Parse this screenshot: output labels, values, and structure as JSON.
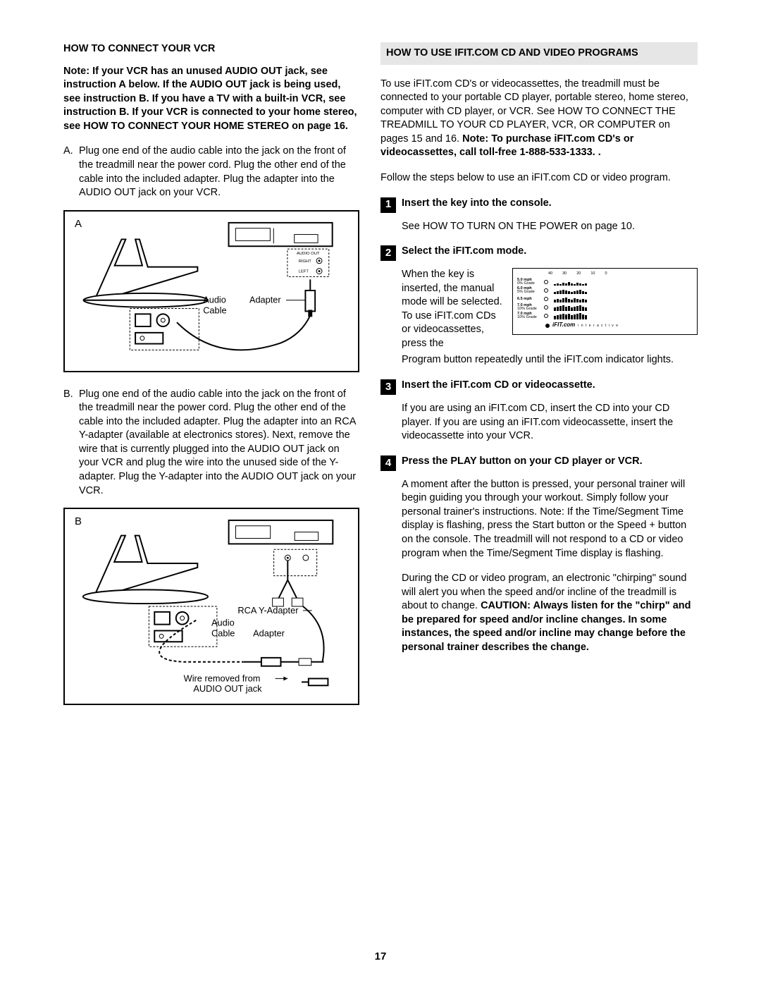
{
  "pageNumber": "17",
  "left": {
    "heading": "HOW TO CONNECT YOUR VCR",
    "note": "Note: If your VCR has an unused AUDIO OUT jack, see instruction A below. If the AUDIO OUT jack is being used, see instruction B. If you have a TV with a built-in VCR, see instruction B. If your VCR is connected to your home stereo, see HOW TO CONNECT YOUR HOME STEREO on page 16.",
    "stepA_marker": "A.",
    "stepA_text": "Plug one end of the audio cable into the jack on the front of the treadmill near the power cord. Plug the other end of the cable into the included adapter. Plug the adapter into the AUDIO OUT jack on your VCR.",
    "figA": {
      "label": "A",
      "audio_out": "AUDIO OUT",
      "right": "RIGHT",
      "left": "LEFT",
      "audio_cable": "Audio Cable",
      "adapter": "Adapter"
    },
    "stepB_marker": "B.",
    "stepB_text": "Plug one end of the audio cable into the jack on the front of the treadmill near the power cord. Plug the other end of the cable into the included adapter. Plug the adapter into an RCA Y-adapter (available at electronics stores). Next, remove the wire that is currently plugged into the AUDIO OUT jack on your VCR and plug the wire into the unused side of the Y-adapter. Plug the Y-adapter into the AUDIO OUT jack on your VCR.",
    "figB": {
      "label": "B",
      "rca": "RCA Y-Adapter",
      "audio_cable": "Audio Cable",
      "adapter": "Adapter",
      "wire": "Wire removed from AUDIO OUT jack"
    }
  },
  "right": {
    "heading": "HOW TO USE IFIT.COM CD AND VIDEO PROGRAMS",
    "intro_plain": "To use iFIT.com CD's or videocassettes, the treadmill must be connected to your portable CD player, portable stereo, home stereo, computer with CD player, or VCR. See HOW TO CONNECT THE TREADMILL TO YOUR CD PLAYER, VCR, OR COMPUTER on pages 15 and 16. ",
    "intro_bold": "Note: To purchase iFIT.com CD's or videocassettes, call toll-free 1-888-533-1333. .",
    "follow": "Follow the steps below to use an iFIT.com CD or video program.",
    "s1_num": "1",
    "s1_title": "Insert the key into the console.",
    "s1_body": "See HOW TO TURN ON THE POWER on page 10.",
    "s2_num": "2",
    "s2_title": "Select the iFIT.com mode.",
    "s2_body1": "When the key is inserted, the manual mode will be selected. To use iFIT.com CDs or videocassettes, press the",
    "s2_body2": "Program button repeatedly until the iFIT.com indicator lights.",
    "s3_num": "3",
    "s3_title": "Insert the iFIT.com CD or videocassette.",
    "s3_body": "If you are using an iFIT.com CD, insert the CD into your CD player. If you are using an iFIT.com videocassette, insert the videocassette into your VCR.",
    "s4_num": "4",
    "s4_title": "Press the PLAY button on your CD player or VCR.",
    "s4_body1": "A moment after the button is pressed, your personal trainer will begin guiding you through your workout. Simply follow your personal trainer's instructions. Note: If the Time/Segment Time display is flashing, press the Start button or the Speed + button on the console. The treadmill will not respond to a CD or video program when the Time/Segment Time display is flashing.",
    "s4_body2_plain": "During the CD or video program, an electronic \"chirping\" sound will alert you when the speed and/or incline of the treadmill is about to change. ",
    "s4_body2_bold": "CAUTION: Always listen for the \"chirp\" and be prepared for speed and/or incline changes. In some instances, the speed and/or incline may change before the personal trainer describes the change.",
    "mode_panel": {
      "nums": [
        "40",
        "30",
        "20",
        "10",
        "0"
      ],
      "rows": [
        {
          "l1": "5.0 mph",
          "l2": "0% Grade"
        },
        {
          "l1": "6.0 mph",
          "l2": "5% Grade"
        },
        {
          "l1": "6.5 mph",
          "l2": ""
        },
        {
          "l1": "7.0 mph",
          "l2": "10% Grade"
        },
        {
          "l1": "7.0 mph",
          "l2": "10% Grade"
        }
      ],
      "logo": "iFIT.com",
      "inter": "i n t e r a c t i v e"
    }
  }
}
